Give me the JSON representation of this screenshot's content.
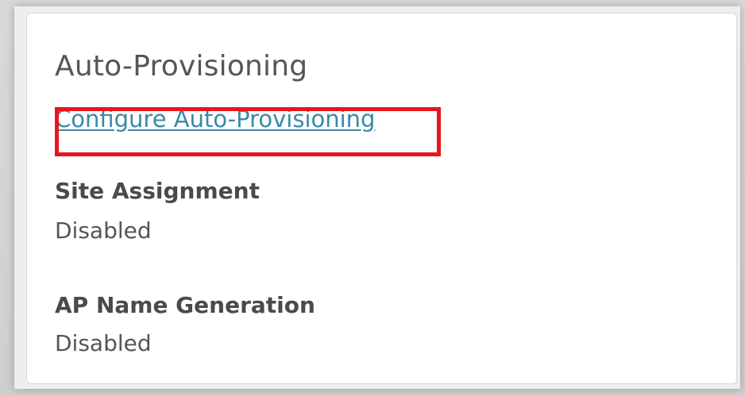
{
  "card": {
    "title": "Auto-Provisioning",
    "configure_link": "Configure Auto-Provisioning",
    "fields": [
      {
        "label": "Site Assignment",
        "value": "Disabled"
      },
      {
        "label": "AP Name Generation",
        "value": "Disabled"
      }
    ]
  },
  "colors": {
    "link": "#3a89a7",
    "highlight": "#e8161c",
    "title_text": "#555555",
    "label_text": "#4a4a4a",
    "card_bg": "#ffffff"
  }
}
